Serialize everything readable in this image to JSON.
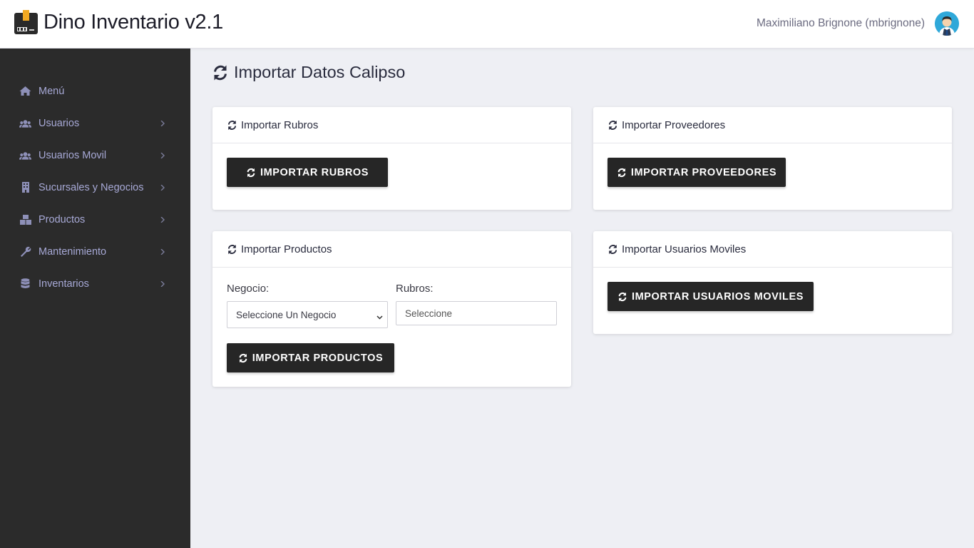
{
  "header": {
    "title": "Dino Inventario v2.1",
    "user_name": "Maximiliano Brignone (mbrignone)"
  },
  "sidebar": {
    "items": [
      {
        "label": "Menú",
        "icon": "home-icon",
        "has_submenu": false
      },
      {
        "label": "Usuarios",
        "icon": "users-icon",
        "has_submenu": true
      },
      {
        "label": "Usuarios Movil",
        "icon": "users-icon",
        "has_submenu": true
      },
      {
        "label": "Sucursales y Negocios",
        "icon": "building-icon",
        "has_submenu": true
      },
      {
        "label": "Productos",
        "icon": "boxes-icon",
        "has_submenu": true
      },
      {
        "label": "Mantenimiento",
        "icon": "wrench-icon",
        "has_submenu": true
      },
      {
        "label": "Inventarios",
        "icon": "database-icon",
        "has_submenu": true
      }
    ]
  },
  "main": {
    "title": "Importar Datos Calipso",
    "cards": {
      "rubros": {
        "header": "Importar Rubros",
        "button": "IMPORTAR RUBROS"
      },
      "proveedores": {
        "header": "Importar Proveedores",
        "button": "IMPORTAR PROVEEDORES"
      },
      "productos": {
        "header": "Importar Productos",
        "negocio_label": "Negocio:",
        "negocio_value": "Seleccione Un Negocio",
        "rubros_label": "Rubros:",
        "rubros_placeholder": "Seleccione",
        "button": "IMPORTAR PRODUCTOS"
      },
      "usuarios_moviles": {
        "header": "Importar Usuarios Moviles",
        "button": "IMPORTAR USUARIOS MOVILES"
      }
    }
  },
  "colors": {
    "sidebar_bg": "#2b2b2b",
    "sidebar_text": "#a7a9d6",
    "button_bg": "#262626",
    "page_bg": "#eeeff4"
  }
}
